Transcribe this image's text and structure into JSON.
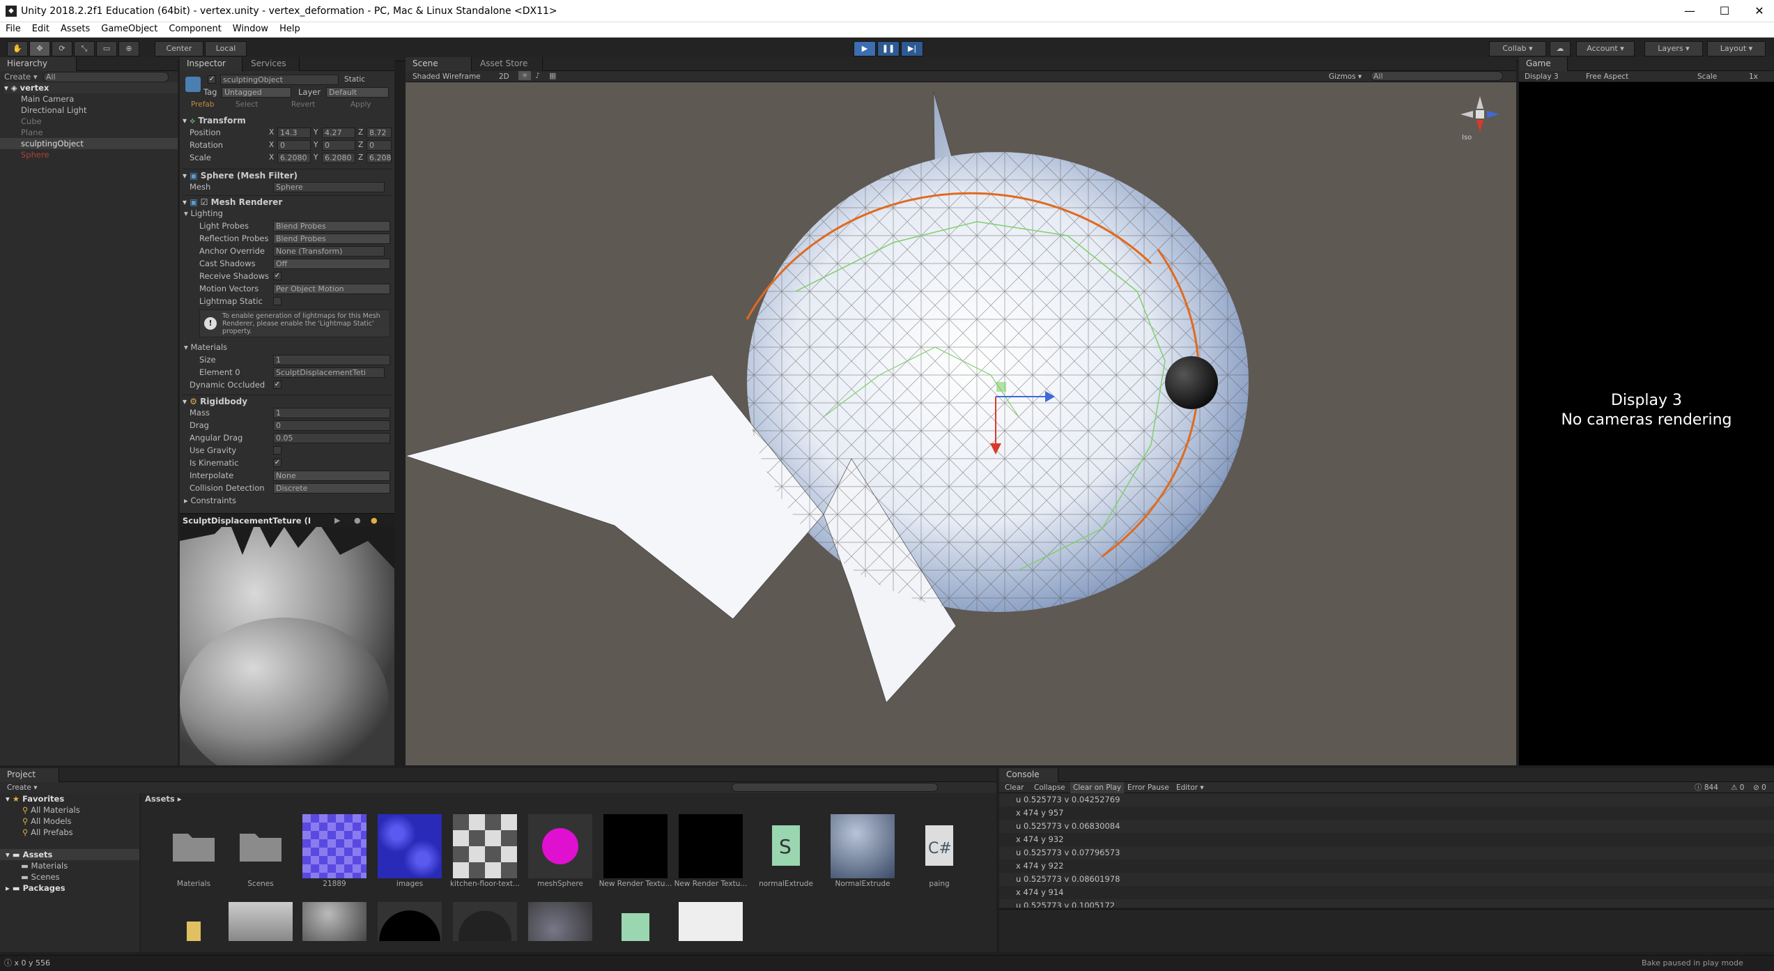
{
  "window": {
    "title": "Unity 2018.2.2f1 Education (64bit) - vertex.unity - vertex_deformation - PC, Mac & Linux Standalone <DX11>",
    "minimize": "—",
    "maximize": "☐",
    "close": "✕"
  },
  "menu": [
    "File",
    "Edit",
    "Assets",
    "GameObject",
    "Component",
    "Window",
    "Help"
  ],
  "toolbar": {
    "center": "Center",
    "local": "Local",
    "collab": "Collab ▾",
    "account": "Account ▾",
    "layers": "Layers ▾",
    "layout": "Layout ▾"
  },
  "hierarchy": {
    "tab": "Hierarchy",
    "create": "Create ▾",
    "search": "All",
    "scene": "vertex",
    "items": [
      "Main Camera",
      "Directional Light",
      "Cube",
      "Plane",
      "sculptingObject",
      "Sphere"
    ]
  },
  "inspector": {
    "tab": "Inspector",
    "tab2": "Services",
    "object_name": "sculptingObject",
    "static": "Static",
    "tag_label": "Tag",
    "tag": "Untagged",
    "layer_label": "Layer",
    "layer": "Default",
    "prefab": "Prefab",
    "select": "Select",
    "revert": "Revert",
    "apply": "Apply",
    "transform": {
      "title": "Transform",
      "rows": [
        {
          "label": "Position",
          "x": "14.3",
          "y": "4.27",
          "z": "8.72"
        },
        {
          "label": "Rotation",
          "x": "0",
          "y": "0",
          "z": "0"
        },
        {
          "label": "Scale",
          "x": "6.2080",
          "y": "6.2080",
          "z": "6.2080"
        }
      ]
    },
    "mesh_filter": {
      "title": "Sphere (Mesh Filter)",
      "mesh_label": "Mesh",
      "mesh": "Sphere"
    },
    "mesh_renderer": {
      "title": "Mesh Renderer",
      "lighting": "Lighting",
      "light_probes_l": "Light Probes",
      "light_probes": "Blend Probes",
      "reflection_l": "Reflection Probes",
      "reflection": "Blend Probes",
      "anchor_l": "Anchor Override",
      "anchor": "None (Transform)",
      "cast_l": "Cast Shadows",
      "cast": "Off",
      "receive_l": "Receive Shadows",
      "motion_l": "Motion Vectors",
      "motion": "Per Object Motion",
      "lightmap_l": "Lightmap Static",
      "info": "To enable generation of lightmaps for this Mesh Renderer, please enable the 'Lightmap Static' property.",
      "materials": "Materials",
      "size_l": "Size",
      "size": "1",
      "element_l": "Element 0",
      "element": "SculptDisplacementTeti",
      "dynamic_l": "Dynamic Occluded"
    },
    "rigidbody": {
      "title": "Rigidbody",
      "mass_l": "Mass",
      "mass": "1",
      "drag_l": "Drag",
      "drag": "0",
      "angular_l": "Angular Drag",
      "angular": "0.05",
      "gravity_l": "Use Gravity",
      "kinematic_l": "Is Kinematic",
      "interp_l": "Interpolate",
      "interp": "None",
      "collision_l": "Collision Detection",
      "collision": "Discrete",
      "constraints": "Constraints"
    },
    "preview_title": "SculptDisplacementTeture (I"
  },
  "scene": {
    "tab": "Scene",
    "tab2": "Asset Store",
    "shading": "Shaded Wireframe",
    "mode2d": "2D",
    "gizmos": "Gizmos ▾",
    "search": "All",
    "persp": "Iso"
  },
  "game": {
    "tab": "Game",
    "display": "Display 3",
    "aspect": "Free Aspect",
    "scale": "Scale",
    "scale_val": "1x",
    "msg1": "Display 3",
    "msg2": "No cameras rendering"
  },
  "project": {
    "tab": "Project",
    "create": "Create ▾",
    "favorites": "Favorites",
    "fav_items": [
      "All Materials",
      "All Models",
      "All Prefabs"
    ],
    "assets": "Assets",
    "asset_children": [
      "Materials",
      "Scenes"
    ],
    "packages": "Packages",
    "breadcrumb": "Assets ▸",
    "items": [
      "Materials",
      "Scenes",
      "21889",
      "images",
      "kitchen-floor-text...",
      "meshSphere",
      "New Render Textu...",
      "New Render Textu...",
      "normalExtrude",
      "NormalExtrude",
      "paing"
    ]
  },
  "console": {
    "tab": "Console",
    "buttons": [
      "Clear",
      "Collapse",
      "Clear on Play",
      "Error Pause",
      "Editor ▾"
    ],
    "count_info": "844",
    "count_warn": "0",
    "count_err": "0",
    "lines": [
      "u 0.525773 v 0.04252769",
      "x 474 y 957",
      "u 0.525773 v 0.06830084",
      "x 474 y 932",
      "u 0.525773 v 0.07796573",
      "x 474 y 922",
      "u 0.525773 v 0.08601978",
      "x 474 y 914",
      "u 0.525773 v 0.1005172"
    ]
  },
  "status": {
    "left": "x 0 y 556",
    "right": "Bake paused in play mode"
  }
}
